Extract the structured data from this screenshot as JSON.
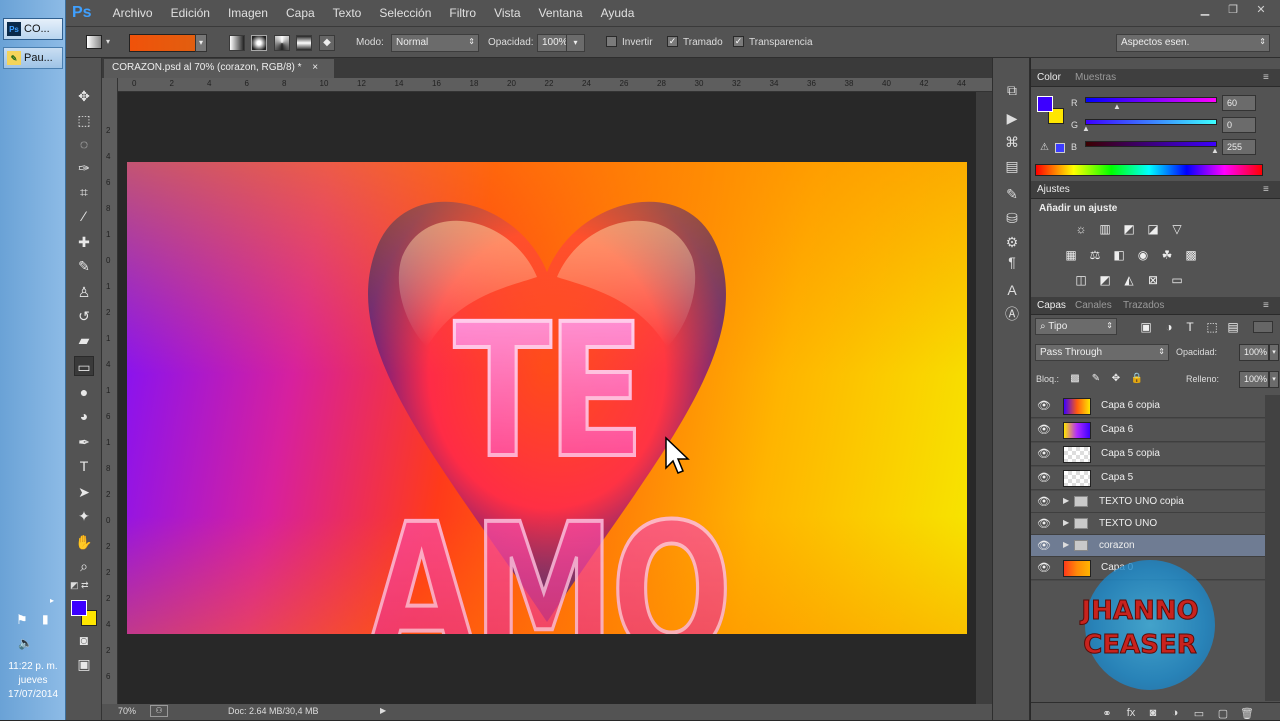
{
  "taskbar": {
    "items": [
      {
        "icon": "ps-icon",
        "label": "CO..."
      },
      {
        "icon": "paint-icon",
        "label": "Pau..."
      }
    ],
    "clock": {
      "time": "11:22 p. m.",
      "day": "jueves",
      "date": "17/07/2014"
    }
  },
  "app": {
    "logo": "Ps",
    "menu": [
      "Archivo",
      "Edición",
      "Imagen",
      "Capa",
      "Texto",
      "Selección",
      "Filtro",
      "Vista",
      "Ventana",
      "Ayuda"
    ]
  },
  "options": {
    "mode_label": "Modo:",
    "mode_value": "Normal",
    "opacity_label": "Opacidad:",
    "opacity_value": "100%",
    "invert_label": "Invertir",
    "dither_label": "Tramado",
    "transparency_label": "Transparencia",
    "workspace": "Aspectos esen.",
    "gradient_colors": [
      "#f0520a",
      "#e06010"
    ]
  },
  "document": {
    "tab_title": "CORAZON.psd al 70% (corazon, RGB/8) *",
    "ruler_ticks": [
      "0",
      "2",
      "4",
      "6",
      "8",
      "10",
      "12",
      "14",
      "16",
      "18",
      "20",
      "22",
      "24",
      "26",
      "28",
      "30",
      "32",
      "34",
      "36",
      "38",
      "40",
      "42",
      "44"
    ],
    "ruler_left_ticks": [
      "2",
      "4",
      "6",
      "8",
      "1",
      "0",
      "1",
      "2",
      "1",
      "4",
      "1",
      "6",
      "1",
      "8",
      "2",
      "0",
      "2",
      "2",
      "2",
      "4",
      "2",
      "6"
    ],
    "artwork_text": "TE AMO",
    "zoom": "70%",
    "doc_info": "Doc: 2.64 MB/30,4 MB"
  },
  "colors": {
    "foreground": "#3c00ff",
    "background": "#ffe600"
  },
  "color_panel": {
    "tabs": [
      "Color",
      "Muestras"
    ],
    "r_label": "R",
    "r_value": "60",
    "g_label": "G",
    "g_value": "0",
    "b_label": "B",
    "b_value": "255"
  },
  "adjust_panel": {
    "tab": "Ajustes",
    "heading": "Añadir un ajuste"
  },
  "layers_panel": {
    "tabs": [
      "Capas",
      "Canales",
      "Trazados"
    ],
    "filter": "Tipo",
    "blend_mode": "Pass Through",
    "opacity_label": "Opacidad:",
    "opacity_value": "100%",
    "lock_label": "Bloq.:",
    "fill_label": "Relleno:",
    "fill_value": "100%",
    "layers": [
      {
        "name": "Capa 6 copia",
        "kind": "pixel",
        "thumb": "gradient"
      },
      {
        "name": "Capa 6",
        "kind": "pixel",
        "thumb": "gradient"
      },
      {
        "name": "Capa 5 copia",
        "kind": "pixel",
        "thumb": "transparent"
      },
      {
        "name": "Capa 5",
        "kind": "pixel",
        "thumb": "transparent"
      },
      {
        "name": "TEXTO UNO copia",
        "kind": "group"
      },
      {
        "name": "TEXTO UNO",
        "kind": "group"
      },
      {
        "name": "corazon",
        "kind": "group",
        "selected": true
      },
      {
        "name": "Capa 0",
        "kind": "pixel",
        "thumb": "orange"
      }
    ]
  },
  "watermark": {
    "line1": "JHANNO",
    "line2": "CEASER"
  }
}
